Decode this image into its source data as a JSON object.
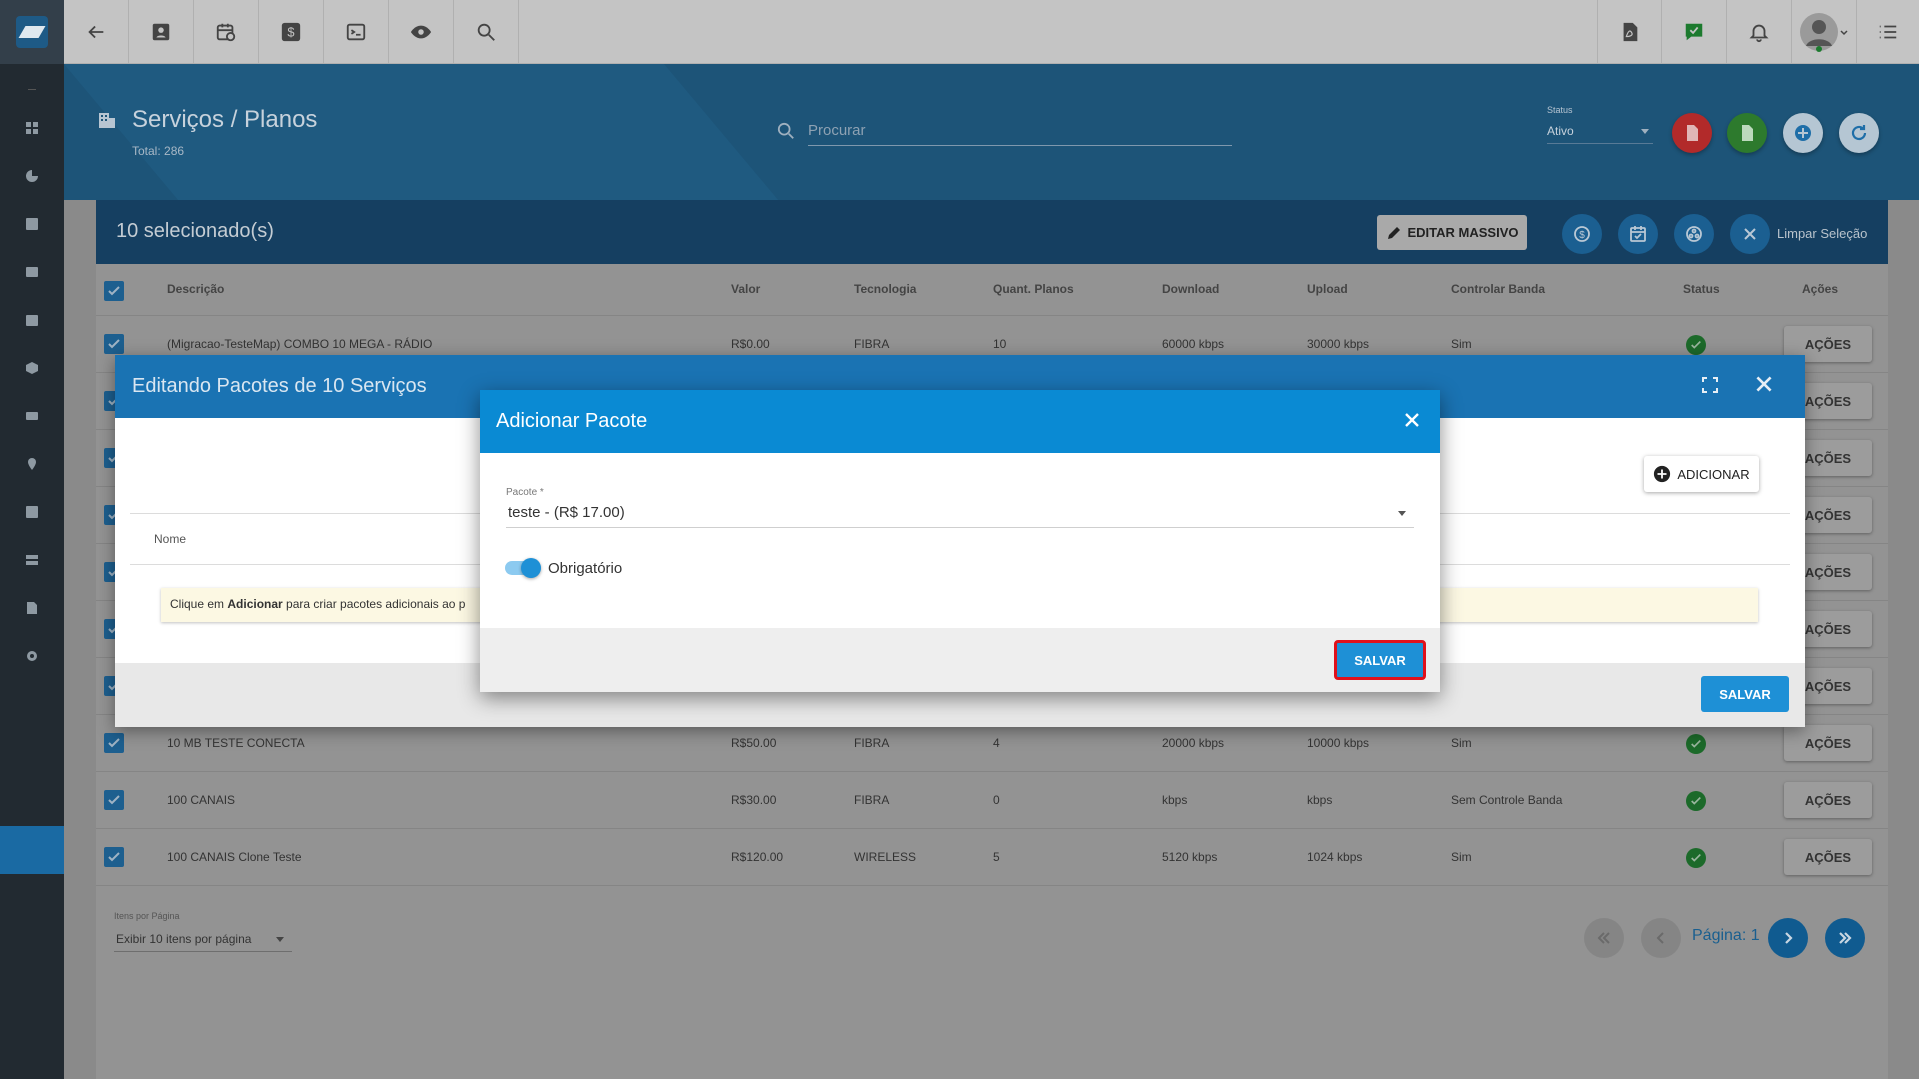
{
  "header": {
    "title": "Serviços / Planos",
    "total": "Total: 286",
    "search_placeholder": "Procurar",
    "status_label": "Status",
    "status_value": "Ativo"
  },
  "selection_bar": {
    "count": "10 selecionado(s)",
    "editar_massivo": "EDITAR MASSIVO",
    "limpar": "Limpar Seleção"
  },
  "table": {
    "columns": [
      "Descrição",
      "Valor",
      "Tecnologia",
      "Quant. Planos",
      "Download",
      "Upload",
      "Controlar Banda",
      "Status",
      "Ações"
    ],
    "rows": [
      {
        "descricao": "(Migracao-TesteMap) COMBO 10 MEGA - RÁDIO",
        "valor": "R$0.00",
        "tecnologia": "FIBRA",
        "quant": "10",
        "download": "60000 kbps",
        "upload": "30000 kbps",
        "controlar": "Sim",
        "acoes": "AÇÕES"
      },
      {
        "acoes": "AÇÕES"
      },
      {
        "acoes": "AÇÕES"
      },
      {
        "acoes": "AÇÕES"
      },
      {
        "acoes": "AÇÕES"
      },
      {
        "acoes": "AÇÕES"
      },
      {
        "acoes": "AÇÕES"
      },
      {
        "descricao": "10 MB TESTE CONECTA",
        "valor": "R$50.00",
        "tecnologia": "FIBRA",
        "quant": "4",
        "download": "20000 kbps",
        "upload": "10000 kbps",
        "controlar": "Sim",
        "acoes": "AÇÕES"
      },
      {
        "descricao": "100 CANAIS",
        "valor": "R$30.00",
        "tecnologia": "FIBRA",
        "quant": "0",
        "download": "kbps",
        "upload": "kbps",
        "controlar": "Sem Controle Banda",
        "acoes": "AÇÕES"
      },
      {
        "descricao": "100 CANAIS Clone Teste",
        "valor": "R$120.00",
        "tecnologia": "WIRELESS",
        "quant": "5",
        "download": "5120 kbps",
        "upload": "1024 kbps",
        "controlar": "Sim",
        "acoes": "AÇÕES"
      }
    ]
  },
  "pagination": {
    "items_label": "Itens por Página",
    "items_value": "Exibir 10 itens por página",
    "page": "Página: 1"
  },
  "modal_edit": {
    "title": "Editando Pacotes de 10 Serviços",
    "adicionar": "ADICIONAR",
    "col_nome": "Nome",
    "note_prefix": "Clique em ",
    "note_bold": "Adicionar",
    "note_suffix": " para criar pacotes adicionais ao p",
    "salvar": "SALVAR"
  },
  "modal_add": {
    "title": "Adicionar Pacote",
    "pacote_label": "Pacote *",
    "pacote_value": "teste - (R$ 17.00)",
    "obrigatorio_label": "Obrigatório",
    "obrigatorio_on": true,
    "salvar": "SALVAR"
  },
  "colors": {
    "primary": "#0a8ad3",
    "modal_header": "#1a73b3",
    "highlight": "#e0111b",
    "ok_status": "#1c6a2a"
  }
}
